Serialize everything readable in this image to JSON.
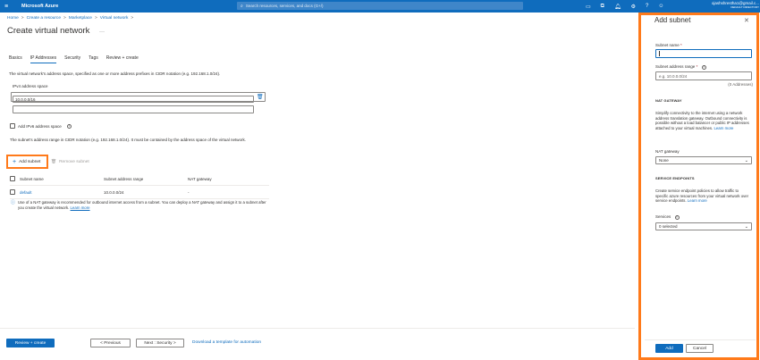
{
  "topbar": {
    "brand": "Microsoft Azure",
    "search_placeholder": "Search resources, services, and docs (G+/)",
    "user_name": "ojashshrestha1@gmail.c...",
    "user_directory": "DEFAULT DIRECTORY",
    "colors": {
      "bar": "#0f6cbd"
    }
  },
  "breadcrumb": [
    "Home",
    "Create a resource",
    "Marketplace",
    "Virtual network"
  ],
  "page": {
    "title": "Create virtual network",
    "more": "···"
  },
  "tabs": [
    "Basics",
    "IP Addresses",
    "Security",
    "Tags",
    "Review + create"
  ],
  "active_tab": "IP Addresses",
  "ip": {
    "description": "The virtual network's address space, specified as one or more address prefixes in CIDR notation (e.g. 192.168.1.0/24).",
    "ipv4_label": "IPv4 address space",
    "ipv4_value": "10.0.0.0/16",
    "ipv6_label": "Add IPv6 address space",
    "subnet_desc": "The subnet's address range in CIDR notation (e.g. 192.168.1.0/24). It must be contained by the address space of the virtual network."
  },
  "subnet_actions": {
    "add": "Add subnet",
    "remove": "Remove subnet"
  },
  "subnet_table": {
    "headers": [
      "Subnet name",
      "Subnet address range",
      "NAT gateway"
    ],
    "rows": [
      {
        "name": "default",
        "range": "10.0.0.0/24",
        "nat": "-"
      }
    ]
  },
  "nat_note": {
    "text": "Use of a NAT gateway is recommended for outbound internet access from a subnet. You can deploy a NAT gateway and assign it to a subnet after you create the virtual network.",
    "link": "Learn more"
  },
  "footer": {
    "review_create": "Review + create",
    "previous": "< Previous",
    "next": "Next : Security >",
    "download": "Download a template for automation"
  },
  "panel": {
    "title": "Add subnet",
    "subnet_name_label": "Subnet name",
    "subnet_range_label": "Subnet address range",
    "subnet_range_placeholder": "e.g. 10.0.0.0/24",
    "addresses": "(0 Addresses)",
    "nat_section": "NAT GATEWAY",
    "nat_text": "Simplify connectivity to the internet using a network address translation gateway. Outbound connectivity is possible without a load balancer or public IP addresses attached to your virtual machines.",
    "nat_link": "Learn more",
    "nat_label": "NAT gateway",
    "nat_value": "None",
    "se_section": "SERVICE ENDPOINTS",
    "se_text": "Create service endpoint policies to allow traffic to specific azure resources from your virtual network over service endpoints.",
    "se_link": "Learn more",
    "services_label": "Services",
    "services_value": "0 selected",
    "add_button": "Add",
    "cancel_button": "Cancel"
  }
}
